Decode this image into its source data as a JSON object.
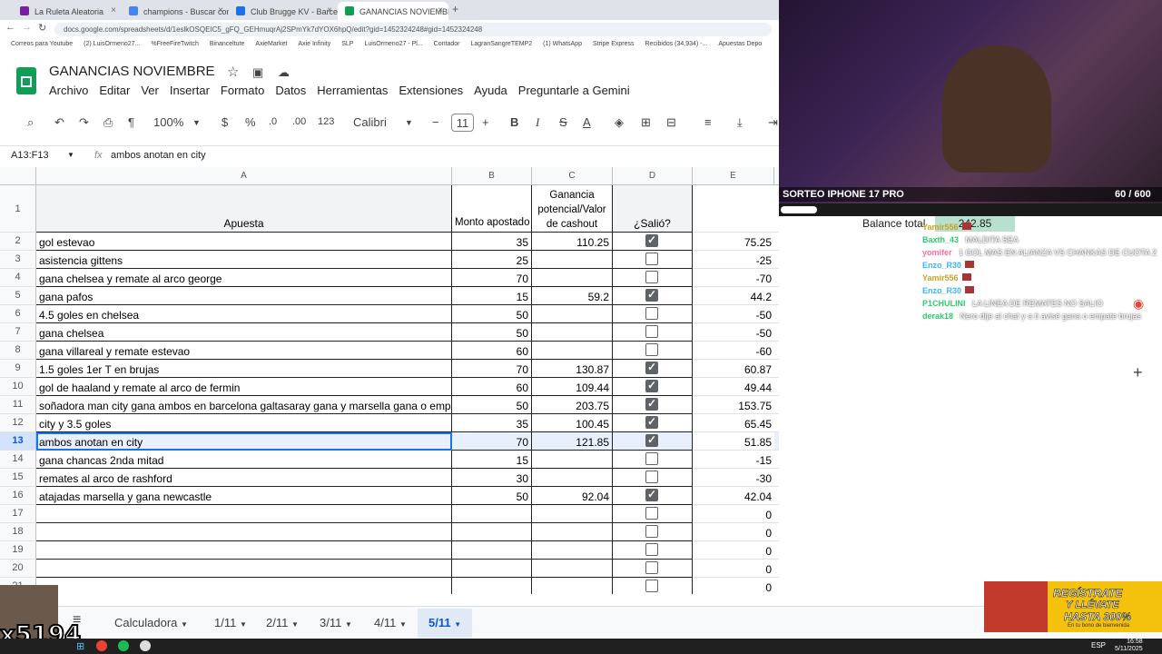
{
  "browser": {
    "tabs": [
      {
        "label": "La Ruleta Aleatoria",
        "color": "#7a1fa2"
      },
      {
        "label": "champions - Buscar con Googl",
        "color": "#4285f4"
      },
      {
        "label": "Club Brugge KV - Barcelona en",
        "color": "#1a73e8"
      },
      {
        "label": "GANANCIAS NOVIEMBRE - Ho",
        "color": "#0f9d58"
      }
    ],
    "url": "docs.google.com/spreadsheets/d/1eslkOSQEIC5_gFQ_GEHmuqrAj2SPmYk7dYOX6hpQ/edit?gid=1452324248#gid=1452324248",
    "bookmarks": [
      "Correos para Youtube",
      "(2) LuisOrmeno27...",
      "%FreeFireTwitch",
      "Binanceltute",
      "AxieMarket",
      "Axie Infinity",
      "SLP",
      "LuisOrmeno27 - Pl...",
      "Contador",
      "LagranSangreTEMP2",
      "(1) WhatsApp",
      "Stripe Express",
      "Recibidos (34,934) -...",
      "Apuestas Depo"
    ]
  },
  "doc": {
    "title": "GANANCIAS NOVIEMBRE",
    "menu": [
      "Archivo",
      "Editar",
      "Ver",
      "Insertar",
      "Formato",
      "Datos",
      "Herramientas",
      "Extensiones",
      "Ayuda",
      "Preguntarle a Gemini"
    ]
  },
  "toolbar": {
    "zoom": "100%",
    "currency": "$",
    "percent": "%",
    "dec_less": ".0",
    "dec_more": ".00",
    "numfmt": "123",
    "font": "Calibri",
    "size": "11"
  },
  "formula": {
    "ref": "A13:F13",
    "fx": "fx",
    "content": "ambos anotan en city"
  },
  "columns": [
    "A",
    "B",
    "C",
    "D",
    "E"
  ],
  "headers": {
    "A": "Apuesta",
    "B": "Monto apostado",
    "C": "Ganancia potencial/Valor de cashout",
    "D": "¿Salió?"
  },
  "rows": [
    {
      "n": "2",
      "a": "gol estevao",
      "b": "35",
      "c": "110.25",
      "d": true,
      "e": "75.25"
    },
    {
      "n": "3",
      "a": "asistencia gittens",
      "b": "25",
      "c": "",
      "d": false,
      "e": "-25"
    },
    {
      "n": "4",
      "a": "gana chelsea y remate al arco george",
      "b": "70",
      "c": "",
      "d": false,
      "e": "-70"
    },
    {
      "n": "5",
      "a": "gana pafos",
      "b": "15",
      "c": "59.2",
      "d": true,
      "e": "44.2"
    },
    {
      "n": "6",
      "a": "4.5 goles en chelsea",
      "b": "50",
      "c": "",
      "d": false,
      "e": "-50"
    },
    {
      "n": "7",
      "a": "gana chelsea",
      "b": "50",
      "c": "",
      "d": false,
      "e": "-50"
    },
    {
      "n": "8",
      "a": "gana villareal y remate estevao",
      "b": "60",
      "c": "",
      "d": false,
      "e": "-60"
    },
    {
      "n": "9",
      "a": "1.5 goles 1er T en brujas",
      "b": "70",
      "c": "130.87",
      "d": true,
      "e": "60.87"
    },
    {
      "n": "10",
      "a": "gol de haaland y remate al arco de fermin",
      "b": "60",
      "c": "109.44",
      "d": true,
      "e": "49.44"
    },
    {
      "n": "11",
      "a": "soñadora man city gana ambos en barcelona galtasaray gana y marsella gana o empata",
      "b": "50",
      "c": "203.75",
      "d": true,
      "e": "153.75"
    },
    {
      "n": "12",
      "a": "city y 3.5 goles",
      "b": "35",
      "c": "100.45",
      "d": true,
      "e": "65.45"
    },
    {
      "n": "13",
      "a": "ambos anotan en city",
      "b": "70",
      "c": "121.85",
      "d": true,
      "e": "51.85"
    },
    {
      "n": "14",
      "a": "gana chancas 2nda mitad",
      "b": "15",
      "c": "",
      "d": false,
      "e": "-15"
    },
    {
      "n": "15",
      "a": "remates al arco de rashford",
      "b": "30",
      "c": "",
      "d": false,
      "e": "-30"
    },
    {
      "n": "16",
      "a": "atajadas marsella y gana newcastle",
      "b": "50",
      "c": "92.04",
      "d": true,
      "e": "42.04"
    },
    {
      "n": "17",
      "a": "",
      "b": "",
      "c": "",
      "d": false,
      "e": "0"
    },
    {
      "n": "18",
      "a": "",
      "b": "",
      "c": "",
      "d": false,
      "e": "0"
    },
    {
      "n": "19",
      "a": "",
      "b": "",
      "c": "",
      "d": false,
      "e": "0"
    },
    {
      "n": "20",
      "a": "",
      "b": "",
      "c": "",
      "d": false,
      "e": "0"
    },
    {
      "n": "21",
      "a": "",
      "b": "",
      "c": "",
      "d": false,
      "e": "0"
    }
  ],
  "balance": {
    "label": "Balance total",
    "value": "242.85"
  },
  "sheets": [
    "Calculadora",
    "1/11",
    "2/11",
    "3/11",
    "4/11",
    "5/11"
  ],
  "active_sheet": "5/11",
  "stream": {
    "banner": "SORTEO IPHONE 17 PRO",
    "counter": "60 / 600",
    "chat": [
      {
        "user": "Yamir556",
        "msg": ""
      },
      {
        "user": "Baxth_43",
        "msg": "MALDITA SEA"
      },
      {
        "user": "yomifer",
        "msg": "1 GOL MAS EN ALIANZA VS CHANKAS DE CUOTA 2"
      },
      {
        "user": "Enzo_R30",
        "msg": ""
      },
      {
        "user": "Yamir556",
        "msg": ""
      },
      {
        "user": "Enzo_R30",
        "msg": ""
      },
      {
        "user": "P1CHULINI",
        "msg": "LA LINEA DE REMATES NO SALIO"
      },
      {
        "user": "derak18",
        "msg": "Nero dije al chat y a ti avisé gana o empate brujas"
      }
    ],
    "ad": {
      "line1": "REGÍSTRATE",
      "line2": "Y LLÉVATE",
      "line3": "HASTA 300%",
      "line4": "En tu bono de bienvenida"
    },
    "overlay_number": "x5194"
  },
  "taskbar": {
    "lang": "ESP",
    "time": "16:58",
    "date": "5/11/2025"
  },
  "colors": {
    "sheets_green": "#0f9d58",
    "selection": "#e8f0fe",
    "selection_border": "#1a73e8"
  }
}
